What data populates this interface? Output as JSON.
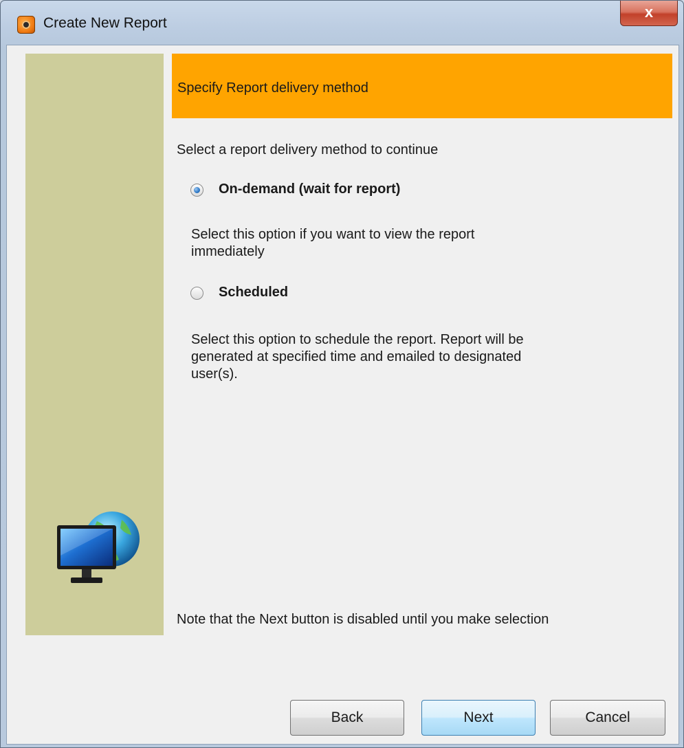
{
  "window": {
    "title": "Create New Report",
    "close_label": "x"
  },
  "header": {
    "title": "Specify Report delivery method"
  },
  "instruction": "Select a report delivery method to continue",
  "options": [
    {
      "label": "On-demand (wait for report)",
      "selected": true,
      "description": [
        "Select this option if you want to view the report",
        "immediately"
      ]
    },
    {
      "label": "Scheduled",
      "selected": false,
      "description": [
        "Select this option to schedule the report. Report will be",
        "generated at specified time and emailed to designated",
        "user(s)."
      ]
    }
  ],
  "note": "Note that the Next button is disabled until you make selection",
  "buttons": {
    "back": "Back",
    "next": "Next",
    "cancel": "Cancel"
  },
  "colors": {
    "accent_band": "#ffa400",
    "side_panel": "#cdcd9b"
  }
}
